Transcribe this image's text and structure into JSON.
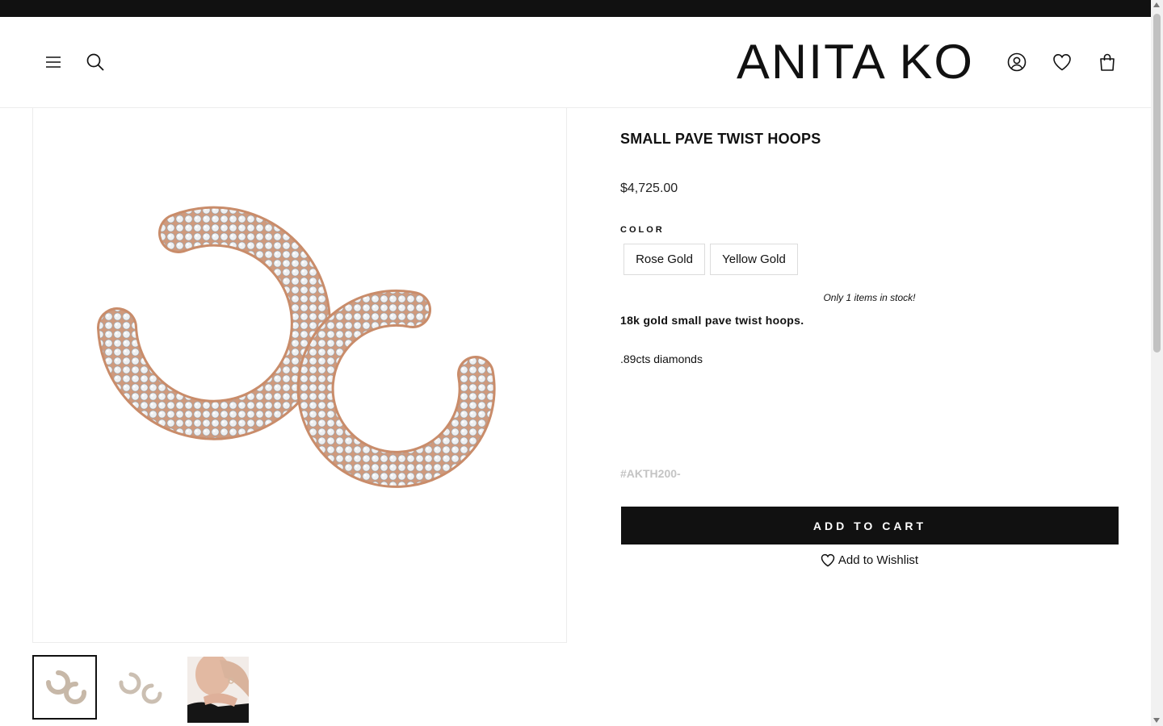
{
  "header": {
    "logo": "ANITA KO",
    "menu_icon": "hamburger-menu-icon",
    "search_icon": "search-icon",
    "account_icon": "user-account-icon",
    "wishlist_icon": "heart-icon",
    "cart_icon": "shopping-bag-icon"
  },
  "product": {
    "title": "SMALL PAVE TWIST HOOPS",
    "price": "$4,725.00",
    "color_label": "COLOR",
    "colors": [
      "Rose Gold",
      "Yellow Gold"
    ],
    "stock_message": "Only 1 items in stock!",
    "description_bold": "18k gold small pave twist hoops.",
    "description": ".89cts diamonds",
    "sku": "#AKTH200-",
    "add_to_cart": "ADD TO CART",
    "add_to_wishlist": "Add to Wishlist"
  },
  "gallery": {
    "thumbnails": [
      "thumbnail-earrings-front",
      "thumbnail-earrings-angle",
      "thumbnail-model-wearing"
    ],
    "active_index": 0
  },
  "colors": {
    "topbar": "#111111",
    "button": "#111111",
    "sku": "#c4c4c4",
    "rose_gold": "#d39a7a"
  }
}
